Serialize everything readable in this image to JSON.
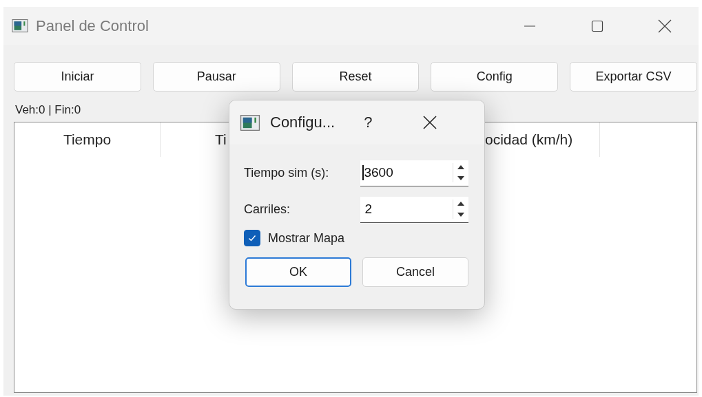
{
  "window": {
    "title": "Panel de Control"
  },
  "toolbar": [
    {
      "label": "Iniciar"
    },
    {
      "label": "Pausar"
    },
    {
      "label": "Reset"
    },
    {
      "label": "Config"
    },
    {
      "label": "Exportar CSV"
    }
  ],
  "status": "Veh:0 | Fin:0",
  "table": {
    "columns": [
      {
        "label": "Tiempo"
      },
      {
        "label": "Ti"
      },
      {
        "label": "ocidad (km/h)"
      }
    ]
  },
  "dialog": {
    "title": "Configu...",
    "help": "?",
    "fields": [
      {
        "label": "Tiempo sim (s):",
        "value": "3600",
        "focused": true
      },
      {
        "label": "Carriles:",
        "value": "2",
        "focused": false
      }
    ],
    "checkbox": {
      "label": "Mostrar Mapa",
      "checked": true
    },
    "buttons": [
      {
        "label": "OK",
        "default": true
      },
      {
        "label": "Cancel",
        "default": false
      }
    ]
  }
}
